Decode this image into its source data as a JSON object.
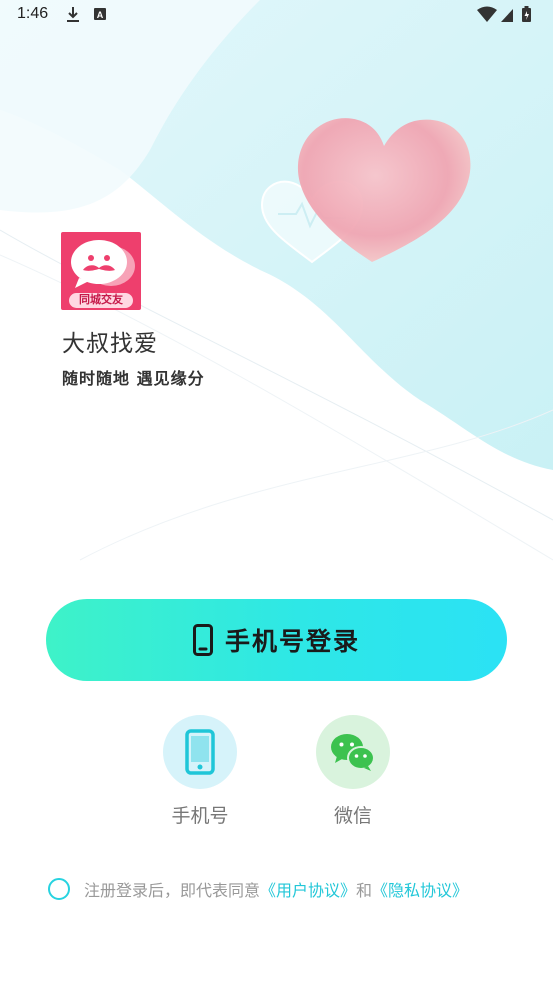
{
  "status_bar": {
    "time": "1:46"
  },
  "app": {
    "logo_text": "同城交友",
    "name": "大叔找爱",
    "slogan": "随时随地  遇见缘分"
  },
  "login": {
    "phone_button_label": "手机号登录",
    "options": [
      {
        "label": "手机号",
        "icon": "phone-icon"
      },
      {
        "label": "微信",
        "icon": "wechat-icon"
      }
    ]
  },
  "agreement": {
    "prefix": "注册登录后，即代表同意",
    "user_agreement": "《用户协议》",
    "conjunction": "和",
    "privacy_policy": "《隐私协议》"
  },
  "colors": {
    "accent": "#2ee7e6",
    "logo_bg": "#ee3f6d",
    "link": "#22c7d8",
    "wechat_green": "#3cc24f"
  }
}
